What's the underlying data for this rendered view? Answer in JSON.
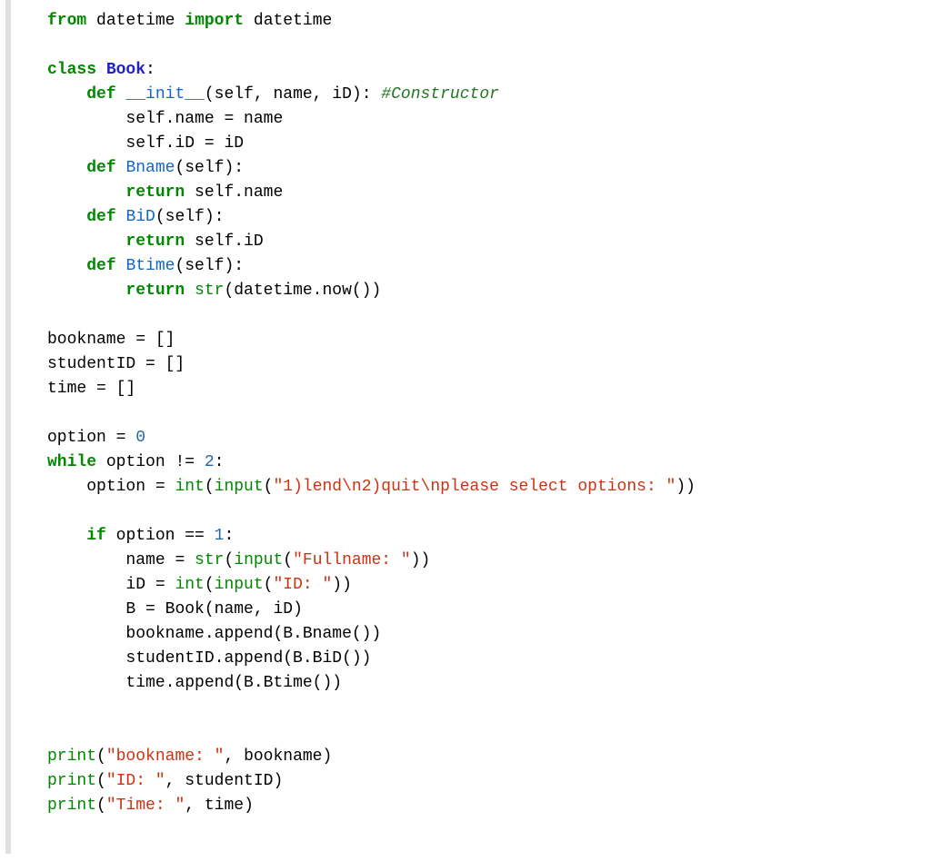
{
  "t": {
    "kw_from": "from",
    "kw_import": "import",
    "kw_class": "class",
    "kw_def": "def",
    "kw_return": "return",
    "kw_while": "while",
    "kw_if": "if",
    "mod_datetime1": "datetime",
    "mod_datetime2": "datetime",
    "cls_book": "Book",
    "fn_init": "__init__",
    "fn_bname": "Bname",
    "fn_bid": "BiD",
    "fn_btime": "Btime",
    "bi_str": "str",
    "bi_int": "int",
    "bi_input": "input",
    "bi_print": "print",
    "var_self": "self",
    "var_name": "name",
    "var_id": "iD",
    "var_bookname": "bookname",
    "var_studentid": "studentID",
    "var_time": "time",
    "var_option": "option",
    "var_b": "B",
    "num_0": "0",
    "num_1": "1",
    "num_2": "2",
    "s_init_args": "(self, name, iD): ",
    "s_self_args": "(self):",
    "cmt_constr": "#Constructor",
    "str_menu": "\"1)lend\\n2)quit\\nplease select options: \"",
    "str_fullname": "\"Fullname: \"",
    "str_id": "\"ID: \"",
    "str_bookname": "\"bookname: \"",
    "str_idlbl": "\"ID: \"",
    "str_time": "\"Time: \"",
    "p_self_name_eq": "self.name = name",
    "p_self_id_eq": "self.iD = iD",
    "p_ret_self_name": " self.name",
    "p_ret_self_id": " self.iD",
    "p_dt_now": "(datetime.now())",
    "p_emptylist": " = []",
    "p_op_eq": " = ",
    "p_neq": " != ",
    "p_eqeq": " == ",
    "p_colon": ":",
    "p_paren_o": "(",
    "p_paren_c": ")",
    "p_pparen_c": "))",
    "p_comma_sp": ", ",
    "p_book_call": " = Book(name, iD)",
    "p_append_bname": ".append(B.Bname())",
    "p_append_bid": ".append(B.BiD())",
    "p_append_btime": ".append(B.Btime())"
  }
}
